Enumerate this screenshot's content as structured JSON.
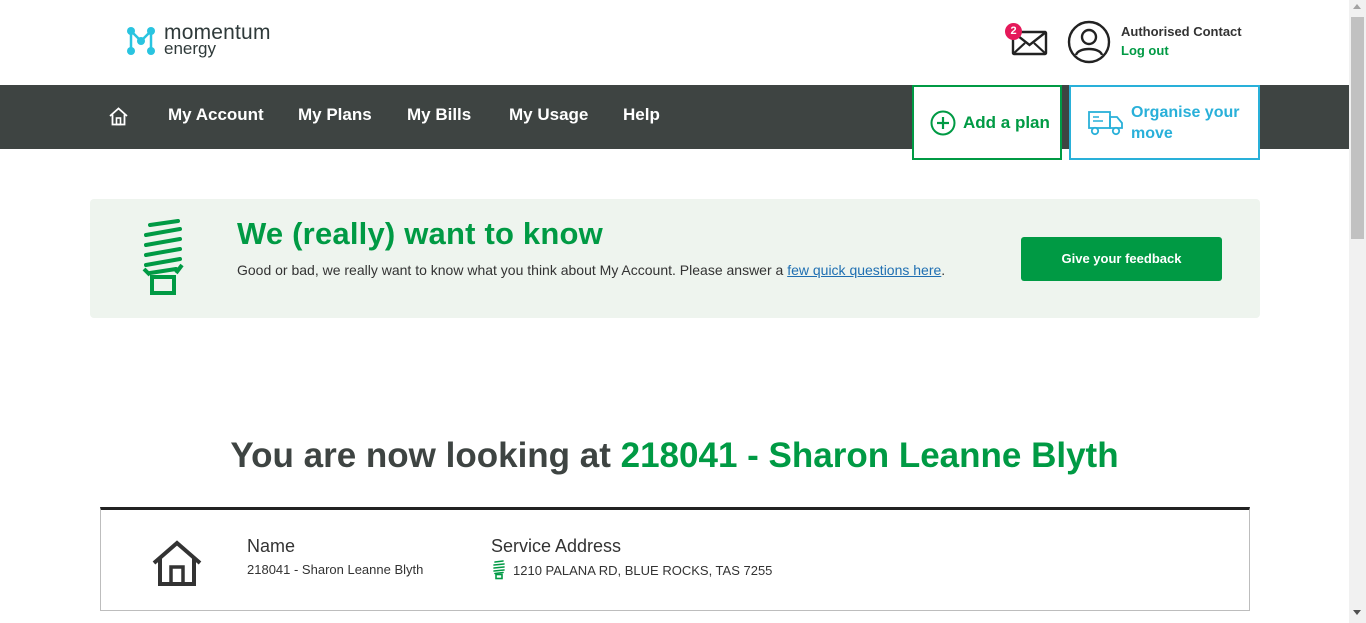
{
  "header": {
    "logo_line1": "momentum",
    "logo_line2": "energy",
    "mail_count": "2",
    "contact_name": "Authorised Contact",
    "logout_label": "Log out"
  },
  "nav": {
    "home_icon": "home-icon",
    "items": [
      "My Account",
      "My Plans",
      "My Bills",
      "My Usage",
      "Help"
    ],
    "add_plan_label": "Add a plan",
    "organise_move_label": "Organise your move"
  },
  "banner": {
    "title": "We (really) want to know",
    "text_before": "Good or bad, we really want to know what you think about My Account. Please answer a ",
    "link_text": "few quick questions here",
    "text_after": ".",
    "button_label": "Give your feedback"
  },
  "viewing": {
    "prefix": "You are now looking at ",
    "account": "218041 - Sharon Leanne Blyth"
  },
  "account_card": {
    "name_heading": "Name",
    "name_value": "218041 - Sharon Leanne Blyth",
    "address_heading": "Service Address",
    "address_value": "1210 PALANA RD, BLUE ROCKS, TAS 7255"
  },
  "colors": {
    "brand_green": "#009a44",
    "nav_bg": "#3e4442",
    "move_blue": "#29b0d9",
    "banner_bg": "#eef4ee",
    "badge_pink": "#e5195a"
  }
}
